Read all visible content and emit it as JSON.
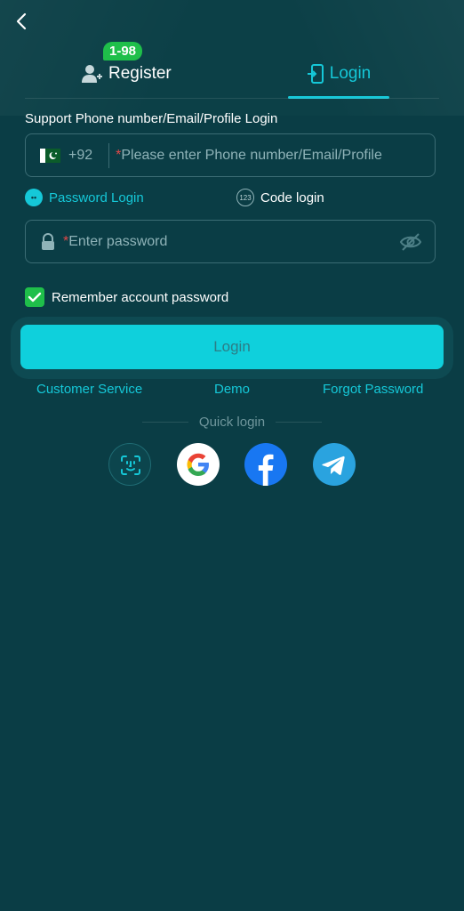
{
  "header": {
    "back_icon": "chevron-left-icon",
    "tabs": [
      {
        "label": "Register",
        "icon": "user-add-icon",
        "badge": "1-98",
        "active": false
      },
      {
        "label": "Login",
        "icon": "login-door-icon",
        "active": true
      }
    ]
  },
  "form": {
    "support_label": "Support Phone number/Email/Profile Login",
    "phone": {
      "country_code": "+92",
      "required_mark": "*",
      "placeholder": "Please enter Phone number/Email/Profile"
    },
    "login_modes": [
      {
        "label": "Password Login",
        "icon": "dots-icon",
        "icon_text": "••",
        "active": true
      },
      {
        "label": "Code login",
        "icon": "code-123-icon",
        "icon_text": "123",
        "active": false
      }
    ],
    "password": {
      "required_mark": "*",
      "placeholder": "Enter password"
    },
    "remember_label": "Remember account password",
    "remember_checked": true,
    "login_button": "Login"
  },
  "links": {
    "customer_service": "Customer Service",
    "demo": "Demo",
    "forgot_password": "Forgot Password"
  },
  "quick_login": {
    "label": "Quick login",
    "providers": [
      "face-id-icon",
      "google-icon",
      "facebook-icon",
      "telegram-icon"
    ]
  },
  "colors": {
    "background": "#0a3d45",
    "accent": "#15c8d8",
    "green": "#1fbf4a",
    "required": "#e04848"
  }
}
